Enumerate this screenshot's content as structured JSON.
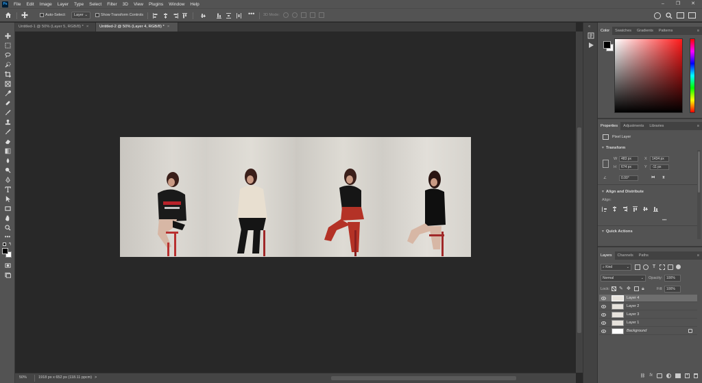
{
  "app": {
    "logo": "Ps"
  },
  "menu": [
    "File",
    "Edit",
    "Image",
    "Layer",
    "Type",
    "Select",
    "Filter",
    "3D",
    "View",
    "Plugins",
    "Window",
    "Help"
  ],
  "options": {
    "auto_select_label": "Auto-Select:",
    "auto_select_value": "Layer",
    "show_transform_label": "Show Transform Controls",
    "mode_3d_label": "3D Mode:"
  },
  "tabs": [
    {
      "label": "Untitled-1 @ 50% (Layer 5, RGB/8) *",
      "close": "×",
      "active": false
    },
    {
      "label": "Untitled-2 @ 50% (Layer 4, RGB/8) *",
      "close": "×",
      "active": true
    }
  ],
  "status": {
    "zoom": "50%",
    "doc_info": "1918 px x 652 px (118.11 ppcm)",
    "arrow": ">"
  },
  "color_panel": {
    "tabs": [
      "Color",
      "Swatches",
      "Gradients",
      "Patterns"
    ],
    "active_tab": "Color",
    "fg": "#000000",
    "bg": "#ffffff",
    "hue": "#ff1a1a"
  },
  "properties": {
    "tabs": [
      "Properties",
      "Adjustments",
      "Libraries"
    ],
    "active_tab": "Properties",
    "kind": "Pixel Layer",
    "transform_title": "Transform",
    "w_label": "W",
    "w_value": "483 px",
    "x_label": "X",
    "x_value": "1434 px",
    "h_label": "H",
    "h_value": "674 px",
    "y_label": "Y",
    "y_value": "-11 px",
    "angle_value": "0.00°",
    "align_title": "Align and Distribute",
    "align_label": "Align:",
    "more": "•••",
    "quick_actions_title": "Quick Actions"
  },
  "layers_panel": {
    "tabs": [
      "Layers",
      "Channels",
      "Paths"
    ],
    "active_tab": "Layers",
    "filter_kind": "Kind",
    "blend_mode": "Normal",
    "opacity_label": "Opacity:",
    "opacity_value": "100%",
    "lock_label": "Lock:",
    "fill_label": "Fill:",
    "fill_value": "100%",
    "layers": [
      {
        "name": "Layer 4",
        "selected": true
      },
      {
        "name": "Layer 2",
        "selected": false
      },
      {
        "name": "Layer 3",
        "selected": false
      },
      {
        "name": "Layer 1",
        "selected": false
      },
      {
        "name": "Background",
        "selected": false,
        "locked": true
      }
    ]
  },
  "colors": {
    "chrome": "#535353",
    "canvas": "#282828",
    "panel_dark": "#424242",
    "selection": "#6e6e6e"
  }
}
